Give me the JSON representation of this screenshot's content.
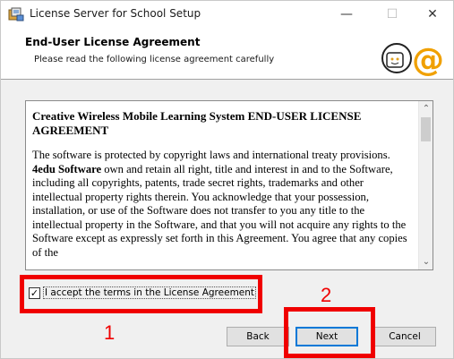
{
  "window": {
    "title": "License Server for School Setup",
    "minimize_glyph": "—",
    "maximize_glyph": "☐",
    "close_glyph": "✕"
  },
  "header": {
    "title": "End-User License Agreement",
    "subtitle": "Please read the following license agreement carefully",
    "logo_icon": "cd-mouse-at-logo-icon"
  },
  "license": {
    "heading": "Creative Wireless Mobile Learning System END-USER LICENSE AGREEMENT",
    "body_part1": "The software is protected by copyright laws and international treaty provisions. ",
    "body_bold": "4edu Software",
    "body_part2": " own and retain all right, title and interest in and to the Software, including all copyrights, patents, trade secret rights, trademarks and other intellectual property rights therein. You acknowledge that your possession, installation, or use of the Software does not transfer to you any title to the intellectual property in the Software, and that you will not acquire any rights to the Software except as expressly set forth in this Agreement. You agree that any copies of the"
  },
  "accept": {
    "label": "I accept the terms in the License Agreement",
    "checked": true
  },
  "buttons": {
    "back": "Back",
    "next": "Next",
    "cancel": "Cancel"
  },
  "annotations": {
    "step1": "1",
    "step2": "2",
    "color": "#f00000"
  }
}
